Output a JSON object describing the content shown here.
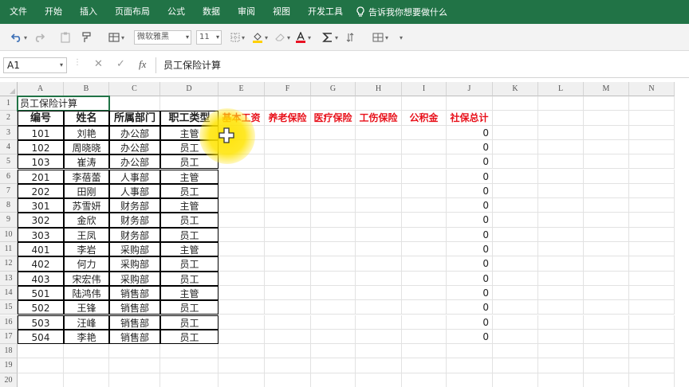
{
  "ribbon": {
    "tabs": [
      "文件",
      "开始",
      "插入",
      "页面布局",
      "公式",
      "数据",
      "审阅",
      "视图",
      "开发工具"
    ],
    "tell_me": "告诉我你想要做什么"
  },
  "toolbar": {
    "font_name": "微软雅黑",
    "font_size": "11",
    "colors": {
      "font_color": "#e81123",
      "fill_color": "#ffd000"
    }
  },
  "formula_bar": {
    "name_box": "A1",
    "cancel_icon": "✕",
    "enter_icon": "✓",
    "fx_label": "fx",
    "content": "员工保险计算"
  },
  "columns": [
    "A",
    "B",
    "C",
    "D",
    "E",
    "F",
    "G",
    "H",
    "I",
    "J",
    "K",
    "L",
    "M",
    "N"
  ],
  "rows": [
    "1",
    "2",
    "3",
    "4",
    "5",
    "6",
    "7",
    "8",
    "9",
    "10",
    "11",
    "12",
    "13",
    "14",
    "15",
    "16",
    "17",
    "18",
    "19",
    "20"
  ],
  "sheet": {
    "title": "员工保险计算",
    "headers": [
      "编号",
      "姓名",
      "所属部门",
      "职工类型"
    ],
    "insurance_headers": [
      "基本工资",
      "养老保险",
      "医疗保险",
      "工伤保险",
      "公积金",
      "社保总计"
    ],
    "records": [
      [
        "101",
        "刘艳",
        "办公部",
        "主管",
        "0"
      ],
      [
        "102",
        "周晓晓",
        "办公部",
        "员工",
        "0"
      ],
      [
        "103",
        "崔涛",
        "办公部",
        "员工",
        "0"
      ],
      [
        "201",
        "李蓓蕾",
        "人事部",
        "主管",
        "0"
      ],
      [
        "202",
        "田刚",
        "人事部",
        "员工",
        "0"
      ],
      [
        "301",
        "苏雪妍",
        "财务部",
        "主管",
        "0"
      ],
      [
        "302",
        "金欣",
        "财务部",
        "员工",
        "0"
      ],
      [
        "303",
        "王凤",
        "财务部",
        "员工",
        "0"
      ],
      [
        "401",
        "李岩",
        "采购部",
        "主管",
        "0"
      ],
      [
        "402",
        "何力",
        "采购部",
        "员工",
        "0"
      ],
      [
        "403",
        "宋宏伟",
        "采购部",
        "员工",
        "0"
      ],
      [
        "501",
        "陆鸿伟",
        "销售部",
        "主管",
        "0"
      ],
      [
        "502",
        "王锋",
        "销售部",
        "员工",
        "0"
      ],
      [
        "503",
        "汪峰",
        "销售部",
        "员工",
        "0"
      ],
      [
        "504",
        "李艳",
        "销售部",
        "员工",
        "0"
      ]
    ]
  }
}
